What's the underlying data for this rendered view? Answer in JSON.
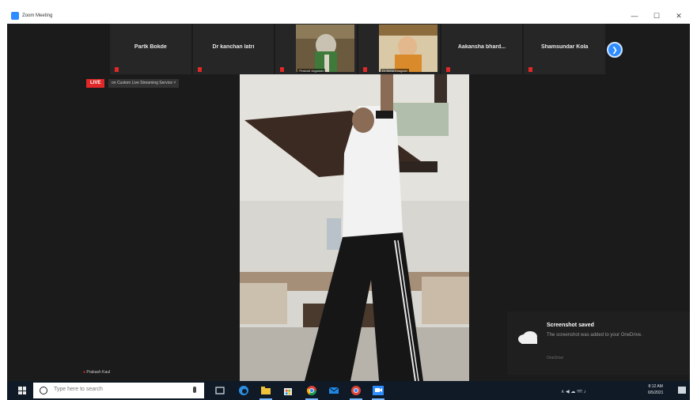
{
  "window": {
    "title": "Zoom Meeting",
    "buttons": [
      "—",
      "☐",
      "✕"
    ]
  },
  "participants": [
    {
      "name": "Partk Bokde",
      "has_video": false
    },
    {
      "name": "Dr kanchan latri",
      "has_video": false
    },
    {
      "name": "",
      "label": "Prakruti Jagadale",
      "has_video": true,
      "icon": "person-in-green-video-thumb"
    },
    {
      "name": "",
      "label": "Dr Neha Bhagwat",
      "has_video": true,
      "icon": "person-in-orange-video-thumb"
    },
    {
      "name": "Aakansha bhard...",
      "has_video": false
    },
    {
      "name": "Shamsundar Kola",
      "has_video": false
    }
  ],
  "strip_next_label": "❯",
  "live": {
    "badge": "LIVE",
    "service": "on Custom Live Streaming Service",
    "chevron": "˅"
  },
  "self_label": "Prakash Kaul",
  "toast": {
    "title": "Screenshot saved",
    "body": "The screenshot was added to your OneDrive.",
    "app": "OneDrive"
  },
  "taskbar": {
    "search_placeholder": "Type here to search",
    "tray_text": "∧  ◀  ☁  আ  ♪",
    "time": "8:12 AM",
    "date": "6/5/2021"
  },
  "colors": {
    "accent": "#2d8cff",
    "live": "#e02828",
    "frame_bg": "#1b1b1b",
    "taskbar_bg": "#0f1a26"
  }
}
